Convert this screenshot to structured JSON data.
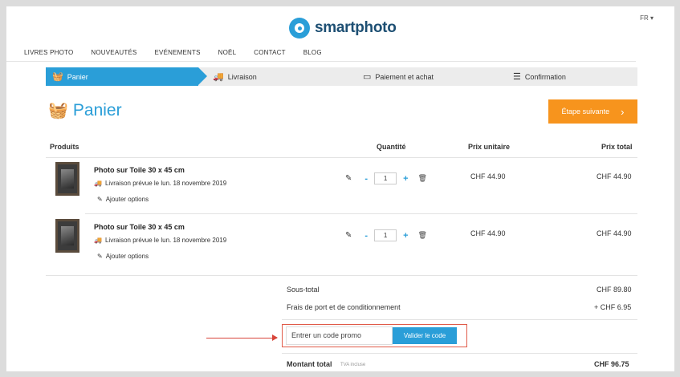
{
  "header": {
    "language": "FR ▾",
    "brand": "smartphoto"
  },
  "nav": {
    "items": [
      "LIVRES PHOTO",
      "NOUVEAUTÉS",
      "EVÉNEMENTS",
      "NOËL",
      "CONTACT",
      "BLOG"
    ]
  },
  "steps": {
    "cart": "Panier",
    "delivery": "Livraison",
    "payment": "Paiement et achat",
    "confirmation": "Confirmation"
  },
  "cart": {
    "title": "Panier",
    "next_button": "Étape suivante",
    "columns": {
      "products": "Produits",
      "quantity": "Quantité",
      "unit_price": "Prix unitaire",
      "total_price": "Prix total"
    },
    "items": [
      {
        "name": "Photo sur Toile 30 x 45 cm",
        "delivery": "Livraison prévue le lun. 18 novembre 2019",
        "options": "Ajouter options",
        "quantity": "1",
        "unit_price": "CHF 44.90",
        "total_price": "CHF 44.90"
      },
      {
        "name": "Photo sur Toile 30 x 45 cm",
        "delivery": "Livraison prévue le lun. 18 novembre 2019",
        "options": "Ajouter options",
        "quantity": "1",
        "unit_price": "CHF 44.90",
        "total_price": "CHF 44.90"
      }
    ]
  },
  "summary": {
    "subtotal_label": "Sous-total",
    "subtotal_value": "CHF 89.80",
    "shipping_label": "Frais de port et de conditionnement",
    "shipping_value": "+ CHF 6.95",
    "promo_placeholder": "Entrer un code promo",
    "promo_button": "Valider le code",
    "total_label": "Montant total",
    "total_note": "TVA incluse",
    "total_value": "CHF 96.75"
  },
  "colors": {
    "accent": "#2a9ed8",
    "cta": "#f7941d",
    "highlight": "#d8453a"
  }
}
